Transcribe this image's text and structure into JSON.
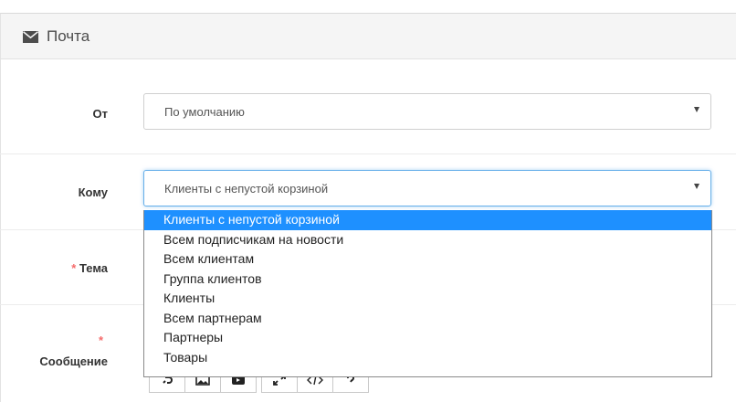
{
  "panel": {
    "title": "Почта",
    "icon": "envelope-icon"
  },
  "form": {
    "from": {
      "label": "От",
      "value": "По умолчанию"
    },
    "to": {
      "label": "Кому",
      "value": "Клиенты с непустой корзиной"
    },
    "subject": {
      "required_mark": "*",
      "label": "Тема"
    },
    "message": {
      "required_mark": "*",
      "label": "Сообщение"
    }
  },
  "dropdown": {
    "selected_index": 0,
    "options": [
      "Клиенты с непустой корзиной",
      "Всем подписчикам на новости",
      "Всем клиентам",
      "Группа клиентов",
      "Клиенты",
      "Всем партнерам",
      "Партнеры",
      "Товары"
    ]
  },
  "editor_toolbar": {
    "groups": [
      [
        "link-icon",
        "picture-icon",
        "video-icon"
      ],
      [
        "fullscreen-icon",
        "code-view-icon",
        "help-icon"
      ]
    ]
  },
  "colors": {
    "accent": "#66afe9",
    "selected_option": "#1e90ff",
    "required": "#f56b6b"
  }
}
